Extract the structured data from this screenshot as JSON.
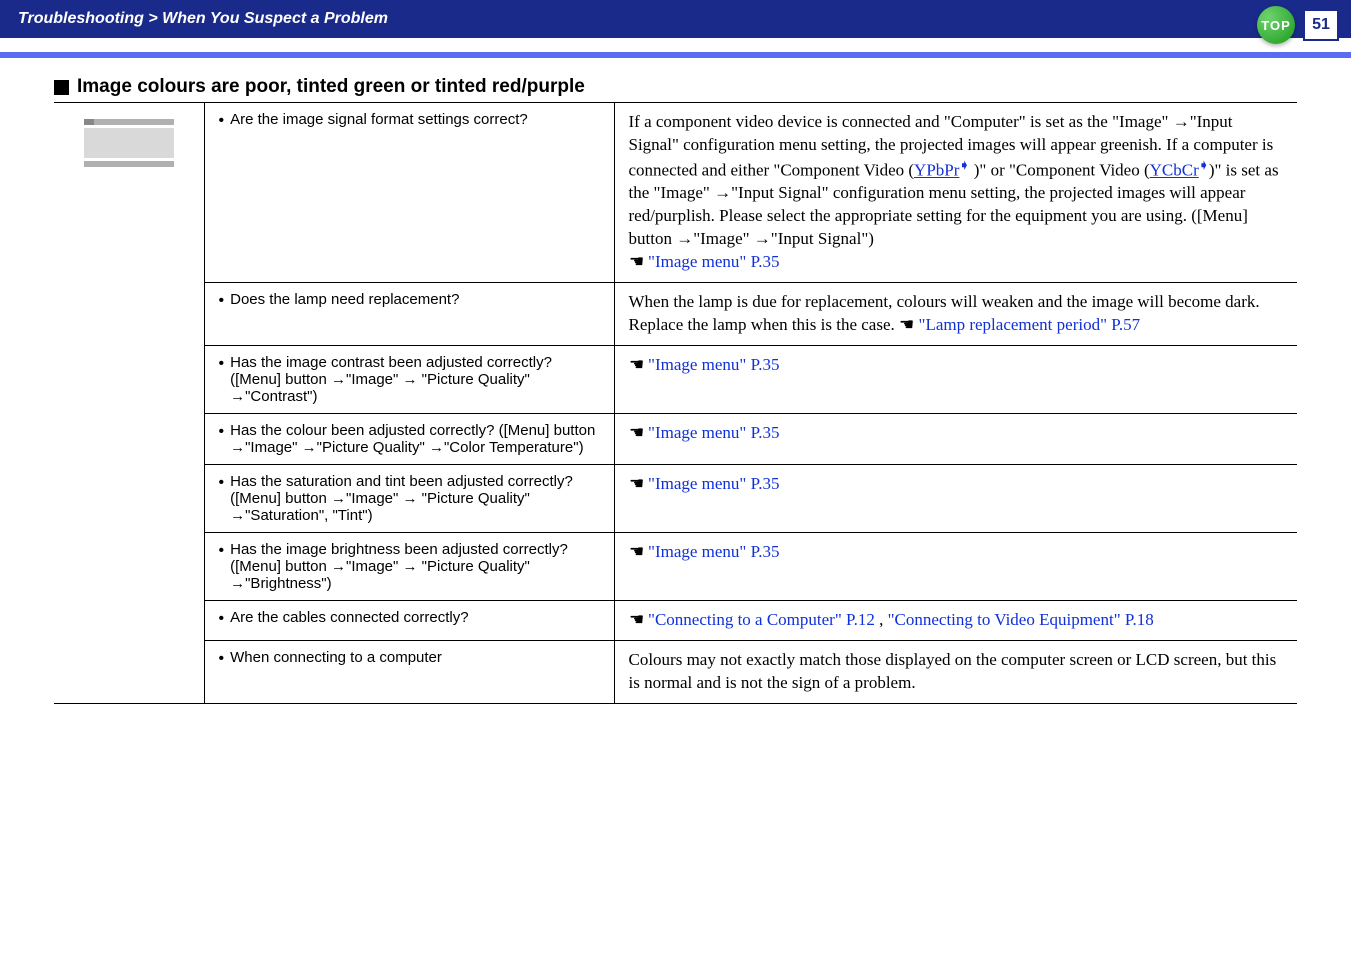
{
  "header": {
    "title": "Troubleshooting > When You Suspect a Problem",
    "top_label": "TOP",
    "page_number": "51"
  },
  "section": {
    "title": "Image colours are poor, tinted green or tinted red/purple"
  },
  "links": {
    "image_menu": "\"Image menu\" P.35",
    "lamp_replace": "\"Lamp replacement period\" P.57",
    "connect_computer": "\"Connecting to a Computer\" P.12",
    "connect_video": "\"Connecting to Video Equipment\" P.18",
    "ypbpr": "YPbPr",
    "ycbcr": "YCbCr"
  },
  "rows": [
    {
      "q": "Are the image signal format settings correct?",
      "a_pre": "If a component video device is connected and \"Computer\" is set as the \"Image\" →\"Input Signal\" configuration menu setting, the projected images will appear greenish. If a computer is connected and either \"Component Video (",
      "a_mid1": " )\" or \"Component Video (",
      "a_mid2": ")\" is set as the \"Image\" →\"Input Signal\" configuration menu setting, the projected images will appear red/purplish. Please select the appropriate setting for the equipment you are using. ([Menu] button →\"Image\" →\"Input Signal\")"
    },
    {
      "q": "Does the lamp need replacement?",
      "a": "When the lamp is due for replacement, colours will weaken and the image will become dark. Replace the lamp when this is the case. "
    },
    {
      "q": "Has the image contrast been adjusted correctly? ([Menu] button →\"Image\" → \"Picture Quality\" →\"Contrast\")"
    },
    {
      "q": "Has the colour been adjusted correctly? ([Menu] button →\"Image\" →\"Picture Quality\" →\"Color Temperature\")"
    },
    {
      "q": "Has the saturation and tint been adjusted correctly? ([Menu] button →\"Image\" → \"Picture Quality\" →\"Saturation\", \"Tint\")"
    },
    {
      "q": "Has the image brightness been adjusted correctly? ([Menu] button →\"Image\" → \"Picture Quality\" →\"Brightness\")"
    },
    {
      "q": "Are the cables connected correctly?"
    },
    {
      "q": "When connecting to a computer",
      "a": "Colours may not exactly match those displayed on the computer screen or LCD screen, but this is normal and is not the sign of a problem."
    }
  ]
}
